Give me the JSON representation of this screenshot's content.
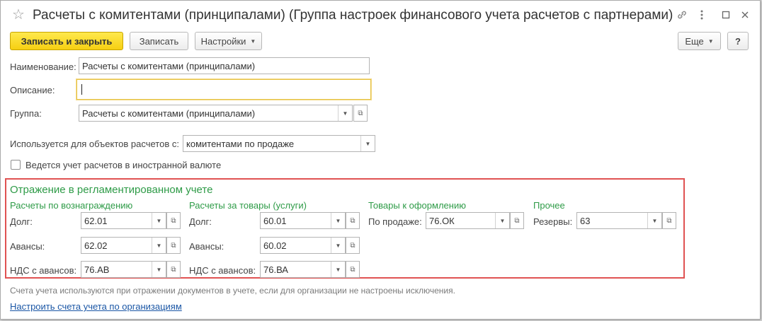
{
  "window": {
    "title": "Расчеты с комитентами (принципалами) (Группа настроек финансового учета расчетов с партнерами)",
    "star_icon": "star-icon",
    "link_icon": "link-icon",
    "more_icon": "more-vertical-icon",
    "maximize_icon": "maximize-icon",
    "close_icon": "close-icon"
  },
  "toolbar": {
    "save_close_label": "Записать и закрыть",
    "save_label": "Записать",
    "settings_label": "Настройки",
    "more_label": "Еще",
    "help_label": "?"
  },
  "form": {
    "name_label": "Наименование:",
    "name_value": "Расчеты с комитентами (принципалами)",
    "description_label": "Описание:",
    "description_value": "",
    "group_label": "Группа:",
    "group_value": "Расчеты с комитентами (принципалами)",
    "used_for_label": "Используется для объектов расчетов с:",
    "used_for_value": "комитентами по продаже",
    "foreign_currency_label": "Ведется учет расчетов в иностранной валюте",
    "foreign_currency_checked": false
  },
  "reg_section": {
    "title": "Отражение в регламентированном учете",
    "commission": {
      "title": "Расчеты по вознаграждению",
      "debt_label": "Долг:",
      "debt_value": "62.01",
      "advances_label": "Авансы:",
      "advances_value": "62.02",
      "vat_label": "НДС с авансов:",
      "vat_value": "76.АВ"
    },
    "goods": {
      "title": "Расчеты за товары (услуги)",
      "debt_label": "Долг:",
      "debt_value": "60.01",
      "advances_label": "Авансы:",
      "advances_value": "60.02",
      "vat_label": "НДС с авансов:",
      "vat_value": "76.ВА"
    },
    "registration": {
      "title": "Товары к оформлению",
      "sale_label": "По продаже:",
      "sale_value": "76.ОК"
    },
    "other": {
      "title": "Прочее",
      "reserves_label": "Резервы:",
      "reserves_value": "63"
    }
  },
  "footer": {
    "hint": "Счета учета используются при отражении документов в учете, если для организации не настроены исключения.",
    "link": "Настроить счета учета по организациям"
  },
  "colors": {
    "accent_yellow": "#f6cf12",
    "section_green": "#2e9b47",
    "highlight_red": "#e05252",
    "link_blue": "#1a56a5"
  }
}
